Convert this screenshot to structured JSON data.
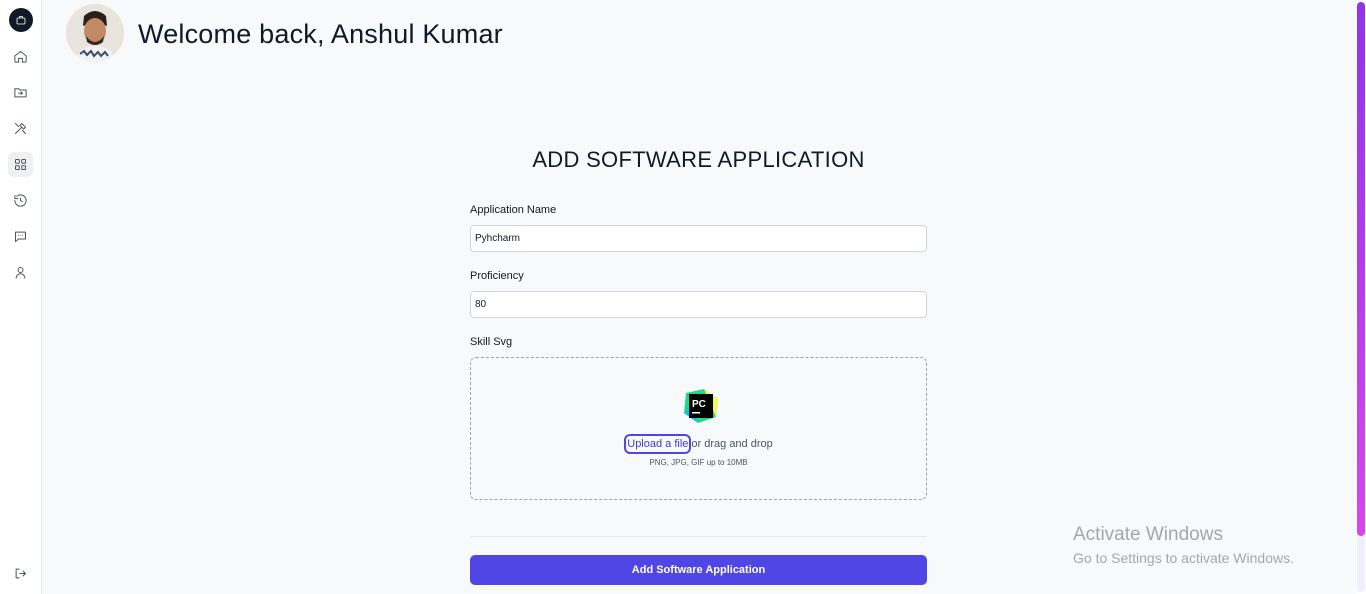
{
  "header": {
    "welcome_text": "Welcome back, Anshul Kumar"
  },
  "sidebar": {
    "items": [
      {
        "name": "home"
      },
      {
        "name": "projects"
      },
      {
        "name": "skills"
      },
      {
        "name": "applications",
        "active": true
      },
      {
        "name": "timeline"
      },
      {
        "name": "messages"
      },
      {
        "name": "account"
      }
    ]
  },
  "form": {
    "title": "ADD SOFTWARE APPLICATION",
    "name_label": "Application Name",
    "name_value": "Pyhcharm",
    "proficiency_label": "Proficiency",
    "proficiency_value": "80",
    "svg_label": "Skill Svg",
    "upload_link": "Upload a file",
    "upload_rest": "or drag and drop",
    "upload_hint": "PNG, JPG, GIF up to 10MB",
    "submit_label": "Add Software Application"
  },
  "watermark": {
    "title": "Activate Windows",
    "subtitle": "Go to Settings to activate Windows."
  },
  "colors": {
    "accent": "#4f46e5",
    "background": "#f8f9fb"
  }
}
